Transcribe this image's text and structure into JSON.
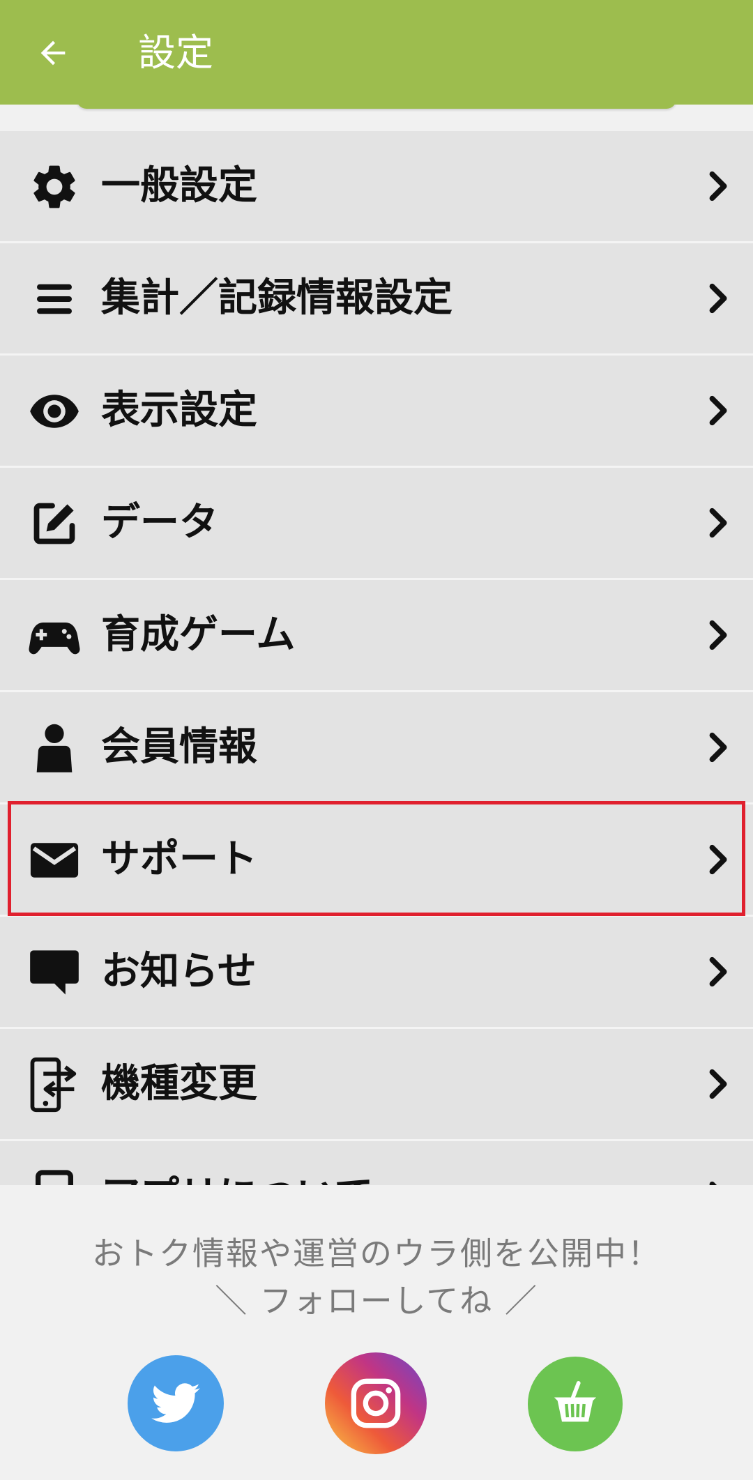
{
  "app_bar": {
    "title": "設定",
    "back_icon": "arrow-left-icon"
  },
  "menu": {
    "items": [
      {
        "label": "一般設定",
        "icon": "gear-icon"
      },
      {
        "label": "集計／記録情報設定",
        "icon": "list-icon"
      },
      {
        "label": "表示設定",
        "icon": "eye-icon"
      },
      {
        "label": "データ",
        "icon": "edit-icon"
      },
      {
        "label": "育成ゲーム",
        "icon": "gamepad-icon"
      },
      {
        "label": "会員情報",
        "icon": "person-icon"
      },
      {
        "label": "サポート",
        "icon": "mail-icon",
        "highlighted": true
      },
      {
        "label": "お知らせ",
        "icon": "chat-bubble-icon"
      },
      {
        "label": "機種変更",
        "icon": "phone-transfer-icon"
      },
      {
        "label": "アプリについて",
        "icon": "phone-icon"
      }
    ],
    "chevron_icon": "chevron-right-icon"
  },
  "footer": {
    "line1": "おトク情報や運営のウラ側を公開中！",
    "line2": "＼ フォローしてね ／",
    "social": [
      {
        "name": "twitter",
        "icon": "twitter-icon",
        "color": "#4ba0ea"
      },
      {
        "name": "instagram",
        "icon": "instagram-icon",
        "color": "#c13584"
      },
      {
        "name": "shop",
        "icon": "basket-icon",
        "color": "#6cc451"
      }
    ]
  },
  "colors": {
    "app_bar": "#9dbd4e",
    "row_bg": "#e3e3e3",
    "highlight": "#e0202e"
  }
}
